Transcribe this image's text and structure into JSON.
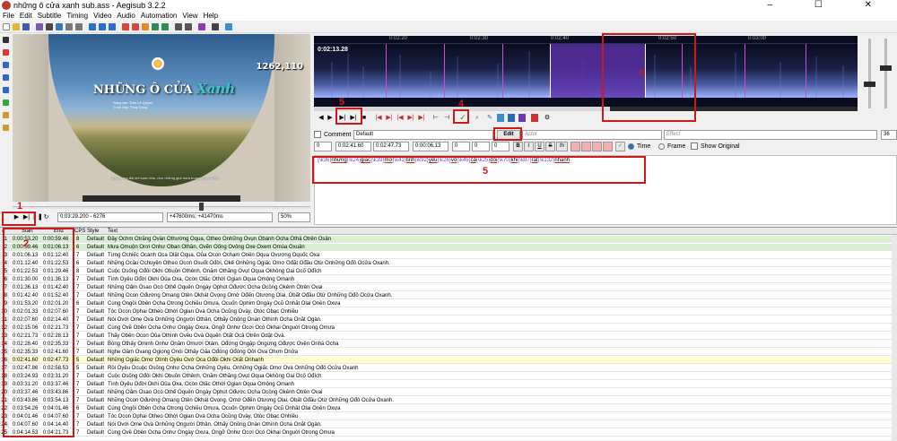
{
  "window": {
    "title": "những ô cửa xanh sub.ass - Aegisub 3.2.2",
    "controls": "– ☐ ✕"
  },
  "menu": [
    "File",
    "Edit",
    "Subtitle",
    "Timing",
    "Video",
    "Audio",
    "Automation",
    "View",
    "Help"
  ],
  "video": {
    "coords": "1262,110",
    "song_title_prefix": "NHỮNG Ô CỬA ",
    "song_title_accent": "Xanh",
    "credits": [
      "Sáng tác: Trần Lê Quỳnh",
      "Trình bày: Thùy Dung"
    ],
    "subtitle_line": "Cuộc sống đôi khi buồn thiu, như những giọt mưa trong lòng cô đơn",
    "time_field": "0:03:29.200 - 6276",
    "offset_field": "+47600ms; +41470ms",
    "zoom": "50%"
  },
  "audio": {
    "time": "0:02:13.28",
    "ruler": [
      "0:02:20",
      "0:02:30",
      "0:02:40",
      "0:02:50",
      "0:03:00"
    ]
  },
  "edit": {
    "comment_label": "Comment",
    "style": "Default",
    "actor_placeholder": "Actor",
    "effect_placeholder": "Effect",
    "layer": "36",
    "layer_value": "0",
    "start": "0:02:41.60",
    "end": "0:02:47.73",
    "duration": "0:00:06.13",
    "margin_l": "0",
    "margin_r": "0",
    "margin_v": "0",
    "edit_button": "Edit",
    "bold": "B",
    "italic": "I",
    "underline": "U",
    "strike": "S",
    "fn": "fn",
    "time_radio": "Time",
    "frame_radio": "Frame",
    "show_original": "Show Original",
    "text_segments": [
      {
        "tag": "{\\k36}",
        "word": "những"
      },
      {
        "tag": "{\\k24}",
        "word": "giấc"
      },
      {
        "tag": "{\\k39}",
        "word": "mơ"
      },
      {
        "tag": "{\\k41}",
        "word": "tinh"
      },
      {
        "tag": "{\\k92}",
        "word": "yêu"
      },
      {
        "tag": "{\\k26}",
        "word": "vô"
      },
      {
        "tag": "{\\k45}",
        "word": "cả"
      },
      {
        "tag": "{\\k25}",
        "word": "đôi"
      },
      {
        "tag": "{\\k70}",
        "word": "khi"
      },
      {
        "tag": "{\\k87}",
        "word": "rất"
      },
      {
        "tag": "{\\k132}",
        "word": "nhanh"
      }
    ]
  },
  "annotations": [
    "1",
    "2",
    "3",
    "4",
    "5"
  ],
  "grid": {
    "headers": [
      "#",
      "Start",
      "End",
      "CPS",
      "Style",
      "Text"
    ],
    "rows": [
      {
        "n": "1",
        "start": "0:00:53.20",
        "end": "0:00:59.46",
        "cps": "8",
        "style": "Default",
        "text": "Đây Ochm Otrăng Ovẫn Othường Oqua, Otheo Onhững Ovụn Obánh Ocha Othả Otrên Osân"
      },
      {
        "n": "2",
        "start": "0:00:59.46",
        "end": "0:01:06.13",
        "cps": "6",
        "style": "Default",
        "text": "Mưa Omuộn Orơi Onhư Oban Othần, Ovẽn Oống Ovông Oxe Oxem Omùa Oxuân"
      },
      {
        "n": "3",
        "start": "0:01:06.13",
        "end": "0:01:12.40",
        "cps": "7",
        "style": "Default",
        "text": "Từng Ochiếc Ocánh Oca Olặt Oqua, Oủa Ocon Ochạm Onền Oqua Ovượng Oquốc Oxa"
      },
      {
        "n": "4",
        "start": "0:01:12.40",
        "end": "0:01:22.53",
        "cps": "6",
        "style": "Default",
        "text": "Những Ocâu Ochuyện Otheo Ocon Osuốt Ođời, Okể Onhững Ogiấc Omơ Ođặt Ođầu Otừ Onhững Ođô Ocửa Oxanh."
      },
      {
        "n": "5",
        "start": "0:01:22.53",
        "end": "0:01:29.46",
        "cps": "8",
        "style": "Default",
        "text": "Cuộc Osống Ođôi Okhi Obuồn Othênh, Onăm Othẳng Ovụt Oqua Okhỏng Oai Ocố Ođích"
      },
      {
        "n": "6",
        "start": "0:01:30.00",
        "end": "0:01:36.13",
        "cps": "7",
        "style": "Default",
        "text": "Tình Oyêu Ođời Okhi Oủa Oxa, Ocòn Otắc Othời Ogian Oqua Omộng Omanh"
      },
      {
        "n": "7",
        "start": "0:01:36.13",
        "end": "0:01:42.40",
        "cps": "7",
        "style": "Default",
        "text": "Những Oẩm Osao Ocó Othể Oquên Ongày Ophút Ođước Ocha Ocồng Okênh Otrên Ovai"
      },
      {
        "n": "8",
        "start": "0:01:42.40",
        "end": "0:01:52.40",
        "cps": "7",
        "style": "Default",
        "text": "Những Ocon Ođường Omang Otên Okhát Ovọng Omờ Ođến Otương Olai, Obất Ođầu Otừ Onhững Ođô Ocửa Oxanh."
      },
      {
        "n": "9",
        "start": "0:01:53.20",
        "end": "0:02:01.20",
        "cps": "6",
        "style": "Default",
        "text": "Cùng Ongồi Obên Ocha Otrong Ochiều Omưa, Ocuốn Ophim Ongày Ocũ Onhắt Olai Onền Oxưa"
      },
      {
        "n": "10",
        "start": "0:02:01.33",
        "end": "0:02:07.60",
        "cps": "7",
        "style": "Default",
        "text": "Tóc Ocon Ophai Otheo Othời Ogian Ovà Ocha Ocũng Ovày, Otóc Obạc Onhiều"
      },
      {
        "n": "11",
        "start": "0:02:07.60",
        "end": "0:02:14.40",
        "cps": "7",
        "style": "Default",
        "text": "Nói Ovới Ome Ovà Onhững Ongười Othân, Othấy Onồng Onàn Othình Ocha Onắt Ogàn."
      },
      {
        "n": "12",
        "start": "0:02:15.06",
        "end": "0:02:21.73",
        "cps": "7",
        "style": "Default",
        "text": "Cùng Ovề Obên Ocha Onhư Ongày Oxưa, Ongỡ Onhư Ocơi Ocó Okhai Onguời Otrong Omưa"
      },
      {
        "n": "13",
        "start": "0:02:21.73",
        "end": "0:02:28.13",
        "cps": "7",
        "style": "Default",
        "text": "Thấy Obên Ocon Oủa Othình Ovêu Ovà Oquên Otất Ocả Otrên Odật Ovà."
      },
      {
        "n": "14",
        "start": "0:02:28.40",
        "end": "0:02:35.33",
        "cps": "7",
        "style": "Default",
        "text": "Bỗng Othấy Ominh Onhư Onăm Omười Otám, Ođứng Ongập Ongừng Ođược Ovên Onhà Ocha"
      },
      {
        "n": "15",
        "start": "0:02:35.33",
        "end": "0:02:41.60",
        "cps": "7",
        "style": "Default",
        "text": "Nghe Oâm Ovang Ogiọng Onói Othấy Oấa Ođóng Ođóng Oởi Ova Ohơn Onửa"
      },
      {
        "n": "16",
        "start": "0:02:41.60",
        "end": "0:02:47.73",
        "cps": "5",
        "style": "Default",
        "text": "Những Ogiấc Omơ Otình Oyêu Ovớ Oca Ođôi Okhi Orất Onhanh"
      },
      {
        "n": "17",
        "start": "0:02:47.86",
        "end": "0:02:58.53",
        "cps": "5",
        "style": "Default",
        "text": "Rồi Oyêu Ocuộc Osống Onhư Ocha Onhững Oyêu, Onhững Ogiấc Omơ Ovà Onhững Ođô Ocửa Oxanh"
      },
      {
        "n": "18",
        "start": "0:03:24.93",
        "end": "0:03:31.20",
        "cps": "7",
        "style": "Default",
        "text": "Cuộc Osống Ođôi Okhi Obuồn Othênh, Onăm Othẳng Ovụt Oqua Okhỏng Oai Ocố Ođích"
      },
      {
        "n": "19",
        "start": "0:03:31.20",
        "end": "0:03:37.46",
        "cps": "7",
        "style": "Default",
        "text": "Tình Oyêu Ođời Okhi Oủa Oxa, Ocòn Otắc Othời Ogian Oqua Omộng Omanh"
      },
      {
        "n": "20",
        "start": "0:03:37.46",
        "end": "0:03:43.86",
        "cps": "7",
        "style": "Default",
        "text": "Những Oẩm Osao Ocó Othể Oquên Ongày Ophút Ođước Ocha Ocồng Okênh Otrên Ovai"
      },
      {
        "n": "21",
        "start": "0:03:43.86",
        "end": "0:03:54.13",
        "cps": "7",
        "style": "Default",
        "text": "Những Ocon Ođường Omang Otên Okhát Ovọng, Omờ Ođến Otương Olai, Obất Ođầu Otừ Onhững Ođô Ocửa Oxanh."
      },
      {
        "n": "22",
        "start": "0:03:54.26",
        "end": "0:04:01.46",
        "cps": "6",
        "style": "Default",
        "text": "Cùng Ongồi Obên Ocha Otrong Ochiều Omưa, Ocuốn Ophim Ongày Ocũ Onhắt Olai Onền Oxưa"
      },
      {
        "n": "23",
        "start": "0:04:01.46",
        "end": "0:04:07.60",
        "cps": "7",
        "style": "Default",
        "text": "Tóc Ocon Ophai Otheo Othời Ogian Ovà Ocha Ocũng Ovày, Otóc Obạc Onhiều"
      },
      {
        "n": "24",
        "start": "0:04:07.60",
        "end": "0:04:14.40",
        "cps": "7",
        "style": "Default",
        "text": "Nói Ovới Ome Ovà Onhững Ongười Othân, Othấy Onồng Onàn Othình Ocha Onắt Ogàn."
      },
      {
        "n": "25",
        "start": "0:04:14.53",
        "end": "0:04:21.73",
        "cps": "7",
        "style": "Default",
        "text": "Cùng Ovề Obên Ocha Onhư Ongày Oxưa, Ongỡ Onhư Ocơi Ocó Okhai Onguời Otrong Omưa"
      }
    ]
  }
}
